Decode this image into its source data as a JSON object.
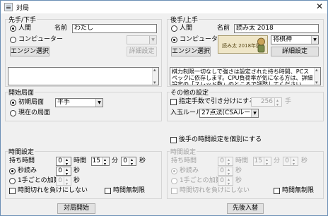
{
  "window": {
    "title": "対局"
  },
  "black": {
    "group_label": "先手/下手",
    "human_label": "人間",
    "computer_label": "コンピューター",
    "name_label": "名前",
    "name_value": "わたし",
    "engine_select_label": "エンジン選択",
    "detail_label": "詳細設定",
    "selected_player": "human"
  },
  "white": {
    "group_label": "後手/上手",
    "human_label": "人間",
    "computer_label": "コンピューター",
    "name_label": "名前",
    "name_value": "読み太 2018",
    "engine_select_label": "エンジン選択",
    "detail_label": "詳細設定",
    "preset_value": "将棋神",
    "logo_text": "読み太 2018年版",
    "info_text": "棋力制限一切なしで強さは設定された持ち時間、PCスペックに依存します。CPU負荷率が気になる方は、詳細設定の「スレッド数」のところで調整してください。",
    "selected_player": "computer"
  },
  "start_position": {
    "group_label": "開始局面",
    "initial_label": "初期局面",
    "current_label": "現在の局面",
    "handicap_value": "平手",
    "selected": "initial"
  },
  "other_settings": {
    "group_label": "その他の設定",
    "draw_moves_label": "指定手数で引き分けにする",
    "draw_moves_value": "256",
    "draw_moves_unit": "手",
    "entering_king_label": "入玉ルール",
    "entering_king_value": "27点法(CSAルール)"
  },
  "separate_time_label": "後手の時間設定を個別にする",
  "time_black": {
    "group_label": "時間設定",
    "hold_time_label": "持ち時間",
    "hours_value": "0",
    "hours_unit": "時間",
    "minutes_value": "15",
    "minutes_unit": "分",
    "seconds_value": "0",
    "seconds_unit": "秒",
    "byoyomi_label": "秒読み",
    "byoyomi_value": "0",
    "byoyomi_unit": "秒",
    "increment_label": "1手ごとの加算",
    "increment_value": "0",
    "increment_unit": "秒",
    "timeout_label": "時間切れを負けにしない",
    "unlimited_label": "時間無制限",
    "selected": "byoyomi"
  },
  "time_white": {
    "group_label": "時間設定",
    "hold_time_label": "持ち時間",
    "hours_value": "0",
    "hours_unit": "時間",
    "minutes_value": "15",
    "minutes_unit": "分",
    "seconds_value": "0",
    "seconds_unit": "秒",
    "byoyomi_label": "秒読み",
    "byoyomi_value": "0",
    "byoyomi_unit": "秒",
    "increment_label": "1手ごとの加算",
    "increment_value": "0",
    "increment_unit": "秒",
    "timeout_label": "時間切れを負けにしない",
    "unlimited_label": "時間無制限",
    "selected": "byoyomi"
  },
  "footer": {
    "start_button": "対局開始",
    "swap_button": "先後入替"
  }
}
